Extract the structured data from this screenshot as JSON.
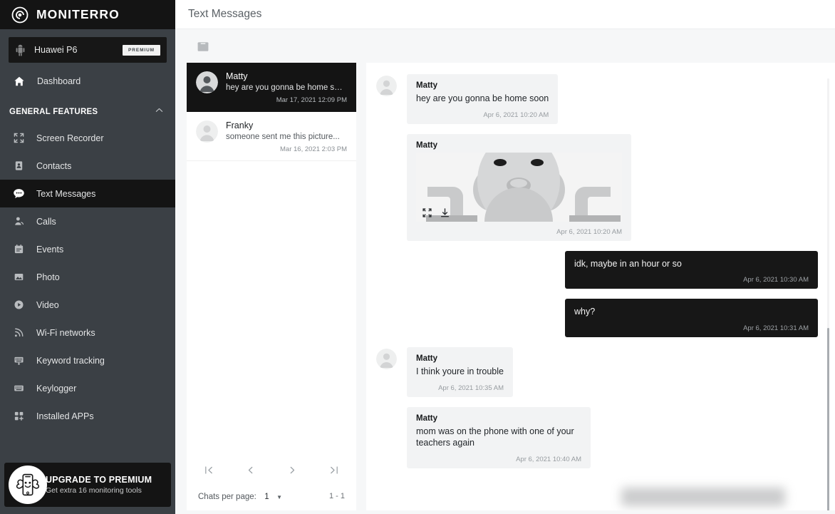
{
  "brand": {
    "name": "MONITERRO",
    "logo_icon": "target-spiral-icon"
  },
  "sidebar": {
    "device": {
      "name": "Huawei P6",
      "badge": "PREMIUM",
      "icon": "android-robot-icon"
    },
    "dashboard": {
      "label": "Dashboard",
      "icon": "home-icon"
    },
    "section": {
      "title": "GENERAL FEATURES",
      "collapse_icon": "chevron-up-icon"
    },
    "items": [
      {
        "label": "Screen Recorder",
        "icon": "expand-frame-icon",
        "active": false
      },
      {
        "label": "Contacts",
        "icon": "contact-card-icon",
        "active": false
      },
      {
        "label": "Text Messages",
        "icon": "chat-bubble-icon",
        "active": true
      },
      {
        "label": "Calls",
        "icon": "person-call-icon",
        "active": false
      },
      {
        "label": "Events",
        "icon": "calendar-icon",
        "active": false
      },
      {
        "label": "Photo",
        "icon": "image-icon",
        "active": false
      },
      {
        "label": "Video",
        "icon": "play-circle-icon",
        "active": false
      },
      {
        "label": "Wi-Fi networks",
        "icon": "wifi-icon",
        "active": false
      },
      {
        "label": "Keyword tracking",
        "icon": "keyboard-alert-icon",
        "active": false
      },
      {
        "label": "Keylogger",
        "icon": "keyboard-icon",
        "active": false
      },
      {
        "label": "Installed APPs",
        "icon": "apps-grid-icon",
        "active": false
      }
    ],
    "upgrade": {
      "title": "UPGRADE TO PREMIUM",
      "subtitle": "Get extra 16 monitoring tools",
      "icon": "strong-phone-icon"
    }
  },
  "topbar": {
    "title": "Text Messages"
  },
  "toolbar": {
    "calendar_icon": "calendar-icon"
  },
  "chat_list": {
    "chats": [
      {
        "name": "Matty",
        "preview": "hey are you gonna be home soon",
        "time": "Mar 17, 2021 12:09 PM",
        "selected": true
      },
      {
        "name": "Franky",
        "preview": "someone sent me this picture...",
        "time": "Mar 16, 2021 2:03 PM",
        "selected": false
      }
    ],
    "pagination": {
      "first_icon": "first-page-icon",
      "prev_icon": "previous-page-icon",
      "next_icon": "next-page-icon",
      "last_icon": "last-page-icon",
      "per_page_label": "Chats per page:",
      "per_page_value": "1",
      "range": "1 - 1"
    }
  },
  "thread": {
    "messages": [
      {
        "direction": "in",
        "sender": "Matty",
        "text": "hey are you gonna be home soon",
        "time": "Apr 6, 2021 10:20 AM",
        "type": "text",
        "show_avatar": true
      },
      {
        "direction": "in",
        "sender": "Matty",
        "text": "",
        "time": "Apr 6, 2021 10:20 AM",
        "type": "image",
        "show_avatar": false,
        "image_alt": "grayscale cartoon face photo",
        "expand_icon": "fullscreen-icon",
        "download_icon": "download-icon"
      },
      {
        "direction": "out",
        "sender": "",
        "text": "idk, maybe in an hour or so",
        "time": "Apr 6, 2021 10:30 AM",
        "type": "text",
        "show_avatar": false
      },
      {
        "direction": "out",
        "sender": "",
        "text": "why?",
        "time": "Apr 6, 2021 10:31 AM",
        "type": "text",
        "show_avatar": false
      },
      {
        "direction": "in",
        "sender": "Matty",
        "text": "I think youre in trouble",
        "time": "Apr 6, 2021 10:35 AM",
        "type": "text",
        "show_avatar": true
      },
      {
        "direction": "in",
        "sender": "Matty",
        "text": "mom was on the phone with one of your teachers again",
        "time": "Apr 6, 2021 10:40 AM",
        "type": "text",
        "show_avatar": false
      }
    ]
  },
  "colors": {
    "sidebar_bg": "#3b4045",
    "sidebar_dark": "#141414",
    "page_bg": "#f6f7f8",
    "panel_bg": "#ffffff",
    "bubble_in": "#f2f3f4",
    "bubble_out": "#171717"
  }
}
